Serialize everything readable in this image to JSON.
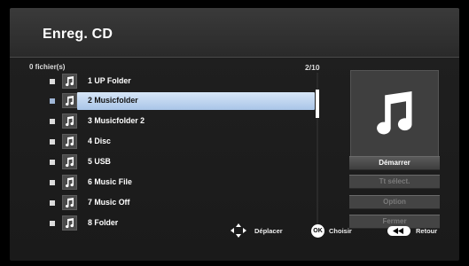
{
  "header": {
    "title": "Enreg. CD"
  },
  "list_info": {
    "file_count": "0 fichier(s)",
    "page": "2/10"
  },
  "items": [
    {
      "label": "1  UP Folder",
      "selected": false
    },
    {
      "label": "2  Musicfolder",
      "selected": true
    },
    {
      "label": "3  Musicfolder 2",
      "selected": false
    },
    {
      "label": "4  Disc",
      "selected": false
    },
    {
      "label": "5  USB",
      "selected": false
    },
    {
      "label": "6  Music File",
      "selected": false
    },
    {
      "label": "7  Music Off",
      "selected": false
    },
    {
      "label": "8  Folder",
      "selected": false
    }
  ],
  "buttons": {
    "start": "Démarrer",
    "select_all": "Tt sélect.",
    "option": "Option",
    "close": "Fermer"
  },
  "help": {
    "move": "Déplacer",
    "ok_icon": "OK",
    "choose": "Choisir",
    "back": "Retour"
  },
  "icons": {
    "item": "music-note-icon",
    "thumbnail": "music-note-icon",
    "move": "arrow-keys-icon",
    "back": "back-button-icon"
  },
  "colors": {
    "selection": "#c3d8f2",
    "background": "#1a1a1a"
  }
}
